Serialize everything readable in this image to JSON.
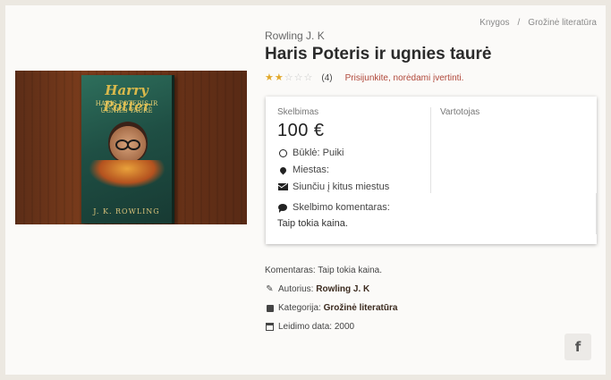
{
  "breadcrumb": {
    "items": [
      "Knygos",
      "Grožinė literatūra"
    ],
    "separator": "/"
  },
  "listing": {
    "author": "Rowling J. K",
    "title": "Haris Poteris ir ugnies taurė",
    "rating": {
      "value": 2,
      "max": 5,
      "count_label": "(4)",
      "login_prompt": "Prisijunkite, norėdami įvertinti."
    }
  },
  "cover": {
    "title_line": "Harry Potter",
    "subtitle_line": "HARIS POTERIS IR UGNIES TAURĖ",
    "author_line": "J. K. ROWLING"
  },
  "card": {
    "ad_label": "Skelbimas",
    "price": "100 €",
    "condition": "Būklė: Puiki",
    "city": "Miestas:",
    "shipping": "Siunčiu į kitus miestus",
    "user_label": "Vartotojas",
    "comment_label": "Skelbimo komentaras:",
    "comment_text": "Taip tokia kaina."
  },
  "meta": {
    "comment": "Komentaras: Taip tokia kaina.",
    "author_label": "Autorius:",
    "author_value": "Rowling J. K",
    "category_label": "Kategorija:",
    "category_value": "Grožinė literatūra",
    "date_label": "Leidimo data:",
    "date_value": "2000"
  },
  "share": {
    "facebook_glyph": "f"
  },
  "colors": {
    "accent_red": "#b0483a",
    "star": "#e2a82a",
    "background": "#ece8e1"
  }
}
